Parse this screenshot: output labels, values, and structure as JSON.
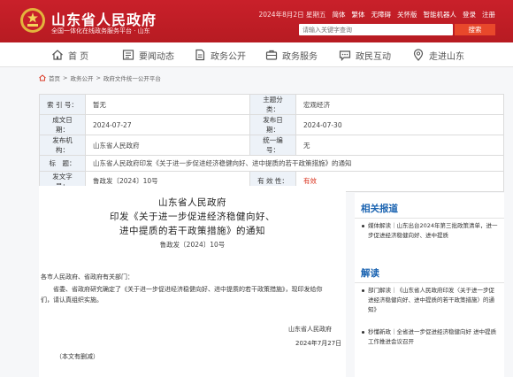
{
  "header": {
    "site_name": "山东省人民政府",
    "site_sub": "全国一体化在线政务服务平台 · 山东",
    "date": "2024年8月2日 星期五",
    "links": [
      "简体",
      "繁体",
      "无障碍",
      "关怀版",
      "智能机器人",
      "登录",
      "注册"
    ],
    "search_placeholder": "请输入关键字查询",
    "search_button": "搜索",
    "brand_color": "#c41f29"
  },
  "nav": [
    {
      "label": "首 页",
      "icon": "home-icon"
    },
    {
      "label": "要闻动态",
      "icon": "news-icon"
    },
    {
      "label": "政务公开",
      "icon": "document-icon"
    },
    {
      "label": "政务服务",
      "icon": "service-icon"
    },
    {
      "label": "政民互动",
      "icon": "chat-icon"
    },
    {
      "label": "走进山东",
      "icon": "location-icon"
    }
  ],
  "breadcrumb": [
    "首页",
    "政务公开",
    "政府文件统一公开平台"
  ],
  "meta": {
    "rows": [
      {
        "k1": "索 引 号：",
        "v1": "暂无",
        "k2": "主题分类：",
        "v2": "宏观经济"
      },
      {
        "k1": "成文日期：",
        "v1": "2024-07-27",
        "k2": "发布日期：",
        "v2": "2024-07-30"
      },
      {
        "k1": "发布机构：",
        "v1": "山东省人民政府",
        "k2": "统一编号：",
        "v2": "无"
      }
    ],
    "title_key": "标　题：",
    "title_val": "山东省人民政府印发《关于进一步促进经济稳健向好、进中提质的若干政策措施》的通知",
    "docno_key": "发文字号：",
    "docno_val": "鲁政发〔2024〕10号",
    "valid_key": "有 效 性：",
    "valid_val": "有效"
  },
  "article": {
    "title1": "山东省人民政府",
    "title2": "印发《关于进一步促进经济稳健向好、",
    "title3": "进中提质的若干政策措施》的通知",
    "docno": "鲁政发〔2024〕10号",
    "para1": "各市人民政府、省政府有关部门：",
    "para2": "省委、省政府研究确定了《关于进一步促进经济稳健向好、进中提质的若干政策措施》，现印发给你",
    "para3": "们，请认真组织实施。",
    "sign_org": "山东省人民政府",
    "sign_date": "2024年7月27日",
    "note": "（本文有删减）"
  },
  "sidebar": {
    "related_title": "相关报道",
    "related": [
      "媒体解读｜山东出台2024年第三批政策清单，进一步促进经济稳健向好、进中提质"
    ],
    "interp_title": "解读",
    "interp": [
      "部门解读｜《山东省人民政府印发〈关于进一步促进经济稳健向好、进中提质的若干政策措施〉的通知》",
      "秒懂新政｜全省进一步促进经济稳健向好 进中提质工作推进会议召开"
    ]
  }
}
